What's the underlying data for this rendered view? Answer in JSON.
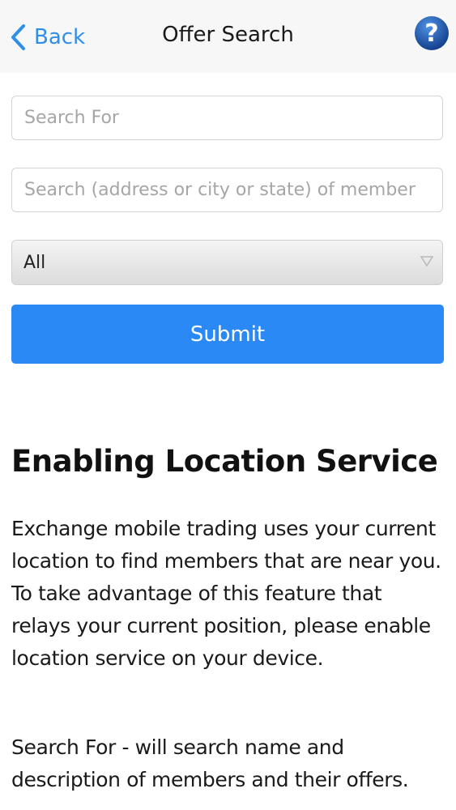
{
  "navbar": {
    "back_label": "Back",
    "title": "Offer Search",
    "help_symbol": "?"
  },
  "form": {
    "search_for": {
      "value": "",
      "placeholder": "Search For"
    },
    "search_location": {
      "value": "",
      "placeholder": "Search (address or city or state) of member"
    },
    "category": {
      "selected": "All"
    },
    "submit_label": "Submit"
  },
  "info": {
    "heading": "Enabling Location Service",
    "paragraph_1": "Exchange mobile trading uses your current location to find members that are near you. To take  advantage of this feature that relays your current position, please enable location service on your device.",
    "paragraph_2": "Search For - will search name and description of members and their offers."
  },
  "colors": {
    "accent": "#2b89f5",
    "back_link": "#2f8fe8",
    "help_badge": "#1a5db8",
    "navbar_bg": "#f7f7f7"
  },
  "icons": {
    "back": "chevron-left-icon",
    "help": "question-mark-icon",
    "dropdown": "triangle-down-icon"
  }
}
